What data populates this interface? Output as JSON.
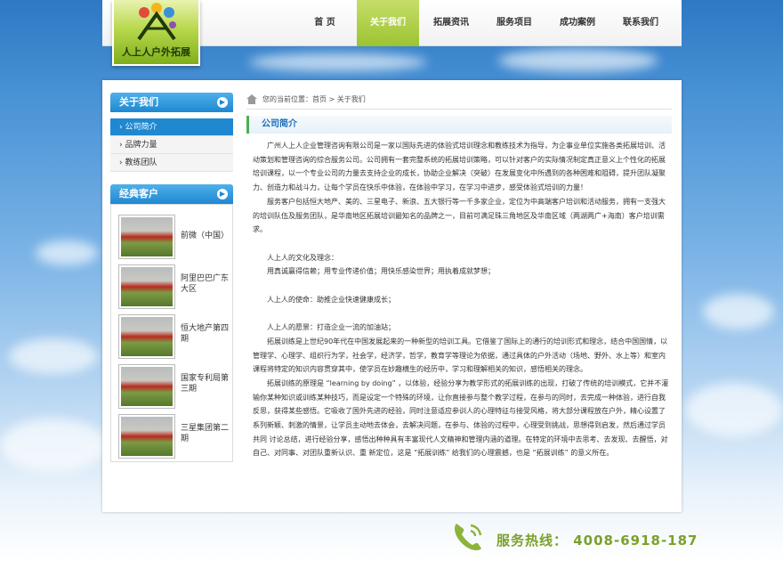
{
  "logo": {
    "text": "人上人户外拓展"
  },
  "nav": [
    {
      "label": "首 页",
      "active": false
    },
    {
      "label": "关于我们",
      "active": true
    },
    {
      "label": "拓展资讯",
      "active": false
    },
    {
      "label": "服务项目",
      "active": false
    },
    {
      "label": "成功案例",
      "active": false
    },
    {
      "label": "联系我们",
      "active": false
    }
  ],
  "sidebar": {
    "about_title": "关于我们",
    "about_items": [
      {
        "label": "公司简介",
        "active": true
      },
      {
        "label": "品牌力量",
        "active": false
      },
      {
        "label": "教练团队",
        "active": false
      }
    ],
    "cases_title": "经典客户",
    "cases": [
      {
        "label": "前微（中国）"
      },
      {
        "label": "阿里巴巴广东大区"
      },
      {
        "label": "恒大地产第四期"
      },
      {
        "label": "国家专利局第三期"
      },
      {
        "label": "三星集团第二期"
      }
    ]
  },
  "breadcrumb": {
    "text": "您的当前位置：首页 > 关于我们"
  },
  "section_title": "公司简介",
  "article": {
    "p1": "广州人上人企业管理咨询有限公司是一家以国际先进的体验式培训理念和教练技术为指导，为企事业单位实施各类拓展培训、活动策划和管理咨询的综合服务公司。公司拥有一套完整系统的拓展培训策略，可以针对客户的实际情况制定真正意义上个性化的拓展培训课程，以一个专业公司的力量去支持企业的成长，协助企业解决（突破）在发展变化中所遇到的各种困难和阻碍，提升团队凝聚力、创造力和战斗力，让每个学员在快乐中体验，在体验中学习，在学习中进步，感受体验式培训的力量！",
    "p2": "服务客户包括恒大地产、美的、三星电子、新浪、五大银行等一千多家企业，定位为中高端客户培训和活动服务，拥有一支强大的培训队伍及服务团队，是华南地区拓展培训最知名的品牌之一，目前可满足珠三角地区及华南区域（两湖两广+海南）客户培训需求。",
    "p3": "人上人的文化及理念：",
    "p4": "用真诚赢得信赖；用专业传递价值；用快乐感染世界；用执着成就梦想；",
    "p5": "人上人的使命：助推企业快速健康成长；",
    "p6": "人上人的愿景：打造企业一流的加油站；",
    "p7": "拓展训练是上世纪90年代在中国发展起来的一种新型的培训工具。它借鉴了国际上的通行的培训形式和理念，结合中国国情，以管理学、心理学、组织行为学，社会学，经济学，哲学，教育学等理论为依据，通过具体的户外活动（场地、野外、水上等）和室内课程将特定的知识内容贯穿其中，使学员在妙趣横生的经历中，学习和理解相关的知识，感悟相关的理念。",
    "p8": "拓展训练的原理是 “learning by doing” ，以体验，经验分享为教学形式的拓展训练的出现，打破了传统的培训模式，它并不灌输你某种知识或训练某种技巧，而是设定一个特殊的环境，让你直接参与整个教学过程，在参与的同时，去完成一种体验，进行自我反思，获得某些感悟。它吸收了国外先进的经验，同时注意适应参训人的心理特征与接受风格，将大部分课程放在户外，精心设置了系列新颖、刺激的情景，让学员主动地去体会，去解决问题，在参与、体验的过程中，心理受到挑战，思想得到启发，然后通过学员共同 讨论总结，进行经验分享，感悟出种种具有丰富现代人文精神和管理内涵的道理。在特定的环境中去思考、去发现、去醒悟，对自己、对同事、对团队重新认识、重 新定位，这是 “拓展训练” 给我们的心理震撼，也是 “拓展训练” 的意义所在。"
  },
  "hotline": {
    "text": "服务热线：  4008-6918-187"
  },
  "colors": {
    "accent_green": "#9cc431",
    "accent_blue": "#1f88d1",
    "hotline_green": "#7aa12a"
  }
}
